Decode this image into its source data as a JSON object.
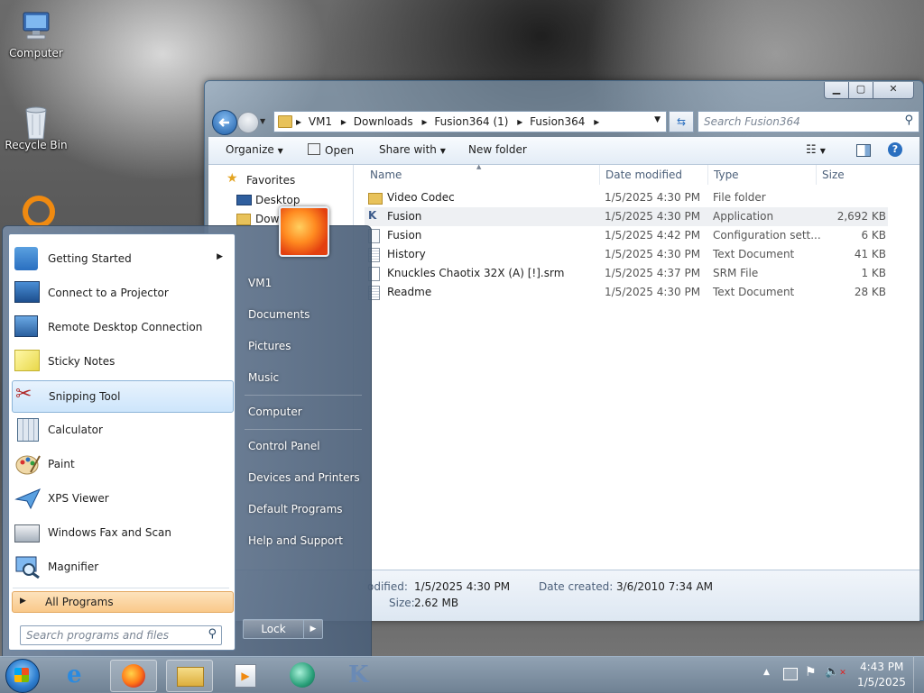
{
  "desktop": {
    "icons": [
      {
        "label": "Computer",
        "icon": "computer-icon"
      },
      {
        "label": "Recycle Bin",
        "icon": "recycle-bin-icon"
      }
    ]
  },
  "explorer": {
    "address_parts": [
      "VM1",
      "Downloads",
      "Fusion364 (1)",
      "Fusion364"
    ],
    "search_placeholder": "Search Fusion364",
    "toolbar": {
      "organize": "Organize",
      "open": "Open",
      "share_with": "Share with",
      "new_folder": "New folder"
    },
    "nav": {
      "favorites": "Favorites",
      "desktop": "Desktop",
      "downloads": "Dow"
    },
    "columns": [
      "Name",
      "Date modified",
      "Type",
      "Size"
    ],
    "files": [
      {
        "name": "Video Codec",
        "date": "1/5/2025 4:30 PM",
        "type": "File folder",
        "size": "",
        "icon": "folder-icon"
      },
      {
        "name": "Fusion",
        "date": "1/5/2025 4:30 PM",
        "type": "Application",
        "size": "2,692 KB",
        "icon": "fusion-app-icon"
      },
      {
        "name": "Fusion",
        "date": "1/5/2025 4:42 PM",
        "type": "Configuration sett...",
        "size": "6 KB",
        "icon": "config-file-icon"
      },
      {
        "name": "History",
        "date": "1/5/2025 4:30 PM",
        "type": "Text Document",
        "size": "41 KB",
        "icon": "text-file-icon"
      },
      {
        "name": "Knuckles Chaotix 32X (A) [!].srm",
        "date": "1/5/2025 4:37 PM",
        "type": "SRM File",
        "size": "1 KB",
        "icon": "file-icon"
      },
      {
        "name": "Readme",
        "date": "1/5/2025 4:30 PM",
        "type": "Text Document",
        "size": "28 KB",
        "icon": "text-file-icon"
      }
    ],
    "details": {
      "modified_label": "odified:",
      "modified_value": "1/5/2025 4:30 PM",
      "created_label": "Date created:",
      "created_value": "3/6/2010 7:34 AM",
      "size_label": "Size:",
      "size_value": "2.62 MB"
    }
  },
  "start_menu": {
    "programs": [
      {
        "label": "Getting Started",
        "icon": "getting-started-icon",
        "submenu": true
      },
      {
        "label": "Connect to a Projector",
        "icon": "projector-icon"
      },
      {
        "label": "Remote Desktop Connection",
        "icon": "remote-desktop-icon"
      },
      {
        "label": "Sticky Notes",
        "icon": "sticky-notes-icon"
      },
      {
        "label": "Snipping Tool",
        "icon": "snipping-tool-icon",
        "selected": true
      },
      {
        "label": "Calculator",
        "icon": "calculator-icon"
      },
      {
        "label": "Paint",
        "icon": "paint-icon"
      },
      {
        "label": "XPS Viewer",
        "icon": "xps-viewer-icon"
      },
      {
        "label": "Windows Fax and Scan",
        "icon": "fax-scan-icon"
      },
      {
        "label": "Magnifier",
        "icon": "magnifier-icon"
      }
    ],
    "all_programs": "All Programs",
    "search_placeholder": "Search programs and files",
    "right_pane": [
      "VM1",
      "Documents",
      "Pictures",
      "Music",
      "Computer",
      "Control Panel",
      "Devices and Printers",
      "Default Programs",
      "Help and Support"
    ],
    "lock_label": "Lock"
  },
  "taskbar": {
    "time": "4:43 PM",
    "date": "1/5/2025",
    "items": [
      "start-orb-icon",
      "internet-explorer-icon",
      "firefox-icon",
      "file-explorer-icon",
      "media-player-icon",
      "app-icon",
      "knuckles-app-icon"
    ]
  },
  "colors": {
    "accent": "#2a6fc0",
    "selection": "#cde5fb",
    "all_programs_bg": "#f9c98a"
  }
}
